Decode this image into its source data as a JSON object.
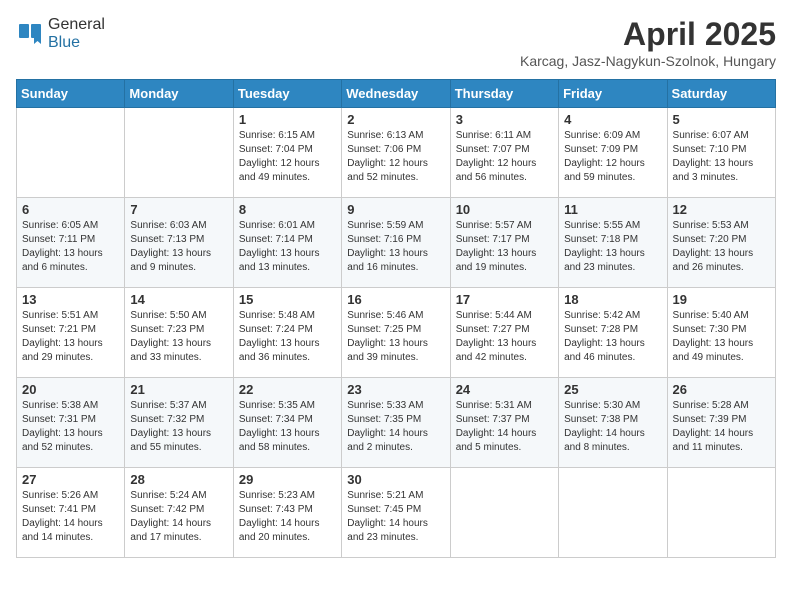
{
  "header": {
    "logo_line1": "General",
    "logo_line2": "Blue",
    "month_title": "April 2025",
    "location": "Karcag, Jasz-Nagykun-Szolnok, Hungary"
  },
  "weekdays": [
    "Sunday",
    "Monday",
    "Tuesday",
    "Wednesday",
    "Thursday",
    "Friday",
    "Saturday"
  ],
  "weeks": [
    [
      {
        "day": "",
        "info": ""
      },
      {
        "day": "",
        "info": ""
      },
      {
        "day": "1",
        "info": "Sunrise: 6:15 AM\nSunset: 7:04 PM\nDaylight: 12 hours and 49 minutes."
      },
      {
        "day": "2",
        "info": "Sunrise: 6:13 AM\nSunset: 7:06 PM\nDaylight: 12 hours and 52 minutes."
      },
      {
        "day": "3",
        "info": "Sunrise: 6:11 AM\nSunset: 7:07 PM\nDaylight: 12 hours and 56 minutes."
      },
      {
        "day": "4",
        "info": "Sunrise: 6:09 AM\nSunset: 7:09 PM\nDaylight: 12 hours and 59 minutes."
      },
      {
        "day": "5",
        "info": "Sunrise: 6:07 AM\nSunset: 7:10 PM\nDaylight: 13 hours and 3 minutes."
      }
    ],
    [
      {
        "day": "6",
        "info": "Sunrise: 6:05 AM\nSunset: 7:11 PM\nDaylight: 13 hours and 6 minutes."
      },
      {
        "day": "7",
        "info": "Sunrise: 6:03 AM\nSunset: 7:13 PM\nDaylight: 13 hours and 9 minutes."
      },
      {
        "day": "8",
        "info": "Sunrise: 6:01 AM\nSunset: 7:14 PM\nDaylight: 13 hours and 13 minutes."
      },
      {
        "day": "9",
        "info": "Sunrise: 5:59 AM\nSunset: 7:16 PM\nDaylight: 13 hours and 16 minutes."
      },
      {
        "day": "10",
        "info": "Sunrise: 5:57 AM\nSunset: 7:17 PM\nDaylight: 13 hours and 19 minutes."
      },
      {
        "day": "11",
        "info": "Sunrise: 5:55 AM\nSunset: 7:18 PM\nDaylight: 13 hours and 23 minutes."
      },
      {
        "day": "12",
        "info": "Sunrise: 5:53 AM\nSunset: 7:20 PM\nDaylight: 13 hours and 26 minutes."
      }
    ],
    [
      {
        "day": "13",
        "info": "Sunrise: 5:51 AM\nSunset: 7:21 PM\nDaylight: 13 hours and 29 minutes."
      },
      {
        "day": "14",
        "info": "Sunrise: 5:50 AM\nSunset: 7:23 PM\nDaylight: 13 hours and 33 minutes."
      },
      {
        "day": "15",
        "info": "Sunrise: 5:48 AM\nSunset: 7:24 PM\nDaylight: 13 hours and 36 minutes."
      },
      {
        "day": "16",
        "info": "Sunrise: 5:46 AM\nSunset: 7:25 PM\nDaylight: 13 hours and 39 minutes."
      },
      {
        "day": "17",
        "info": "Sunrise: 5:44 AM\nSunset: 7:27 PM\nDaylight: 13 hours and 42 minutes."
      },
      {
        "day": "18",
        "info": "Sunrise: 5:42 AM\nSunset: 7:28 PM\nDaylight: 13 hours and 46 minutes."
      },
      {
        "day": "19",
        "info": "Sunrise: 5:40 AM\nSunset: 7:30 PM\nDaylight: 13 hours and 49 minutes."
      }
    ],
    [
      {
        "day": "20",
        "info": "Sunrise: 5:38 AM\nSunset: 7:31 PM\nDaylight: 13 hours and 52 minutes."
      },
      {
        "day": "21",
        "info": "Sunrise: 5:37 AM\nSunset: 7:32 PM\nDaylight: 13 hours and 55 minutes."
      },
      {
        "day": "22",
        "info": "Sunrise: 5:35 AM\nSunset: 7:34 PM\nDaylight: 13 hours and 58 minutes."
      },
      {
        "day": "23",
        "info": "Sunrise: 5:33 AM\nSunset: 7:35 PM\nDaylight: 14 hours and 2 minutes."
      },
      {
        "day": "24",
        "info": "Sunrise: 5:31 AM\nSunset: 7:37 PM\nDaylight: 14 hours and 5 minutes."
      },
      {
        "day": "25",
        "info": "Sunrise: 5:30 AM\nSunset: 7:38 PM\nDaylight: 14 hours and 8 minutes."
      },
      {
        "day": "26",
        "info": "Sunrise: 5:28 AM\nSunset: 7:39 PM\nDaylight: 14 hours and 11 minutes."
      }
    ],
    [
      {
        "day": "27",
        "info": "Sunrise: 5:26 AM\nSunset: 7:41 PM\nDaylight: 14 hours and 14 minutes."
      },
      {
        "day": "28",
        "info": "Sunrise: 5:24 AM\nSunset: 7:42 PM\nDaylight: 14 hours and 17 minutes."
      },
      {
        "day": "29",
        "info": "Sunrise: 5:23 AM\nSunset: 7:43 PM\nDaylight: 14 hours and 20 minutes."
      },
      {
        "day": "30",
        "info": "Sunrise: 5:21 AM\nSunset: 7:45 PM\nDaylight: 14 hours and 23 minutes."
      },
      {
        "day": "",
        "info": ""
      },
      {
        "day": "",
        "info": ""
      },
      {
        "day": "",
        "info": ""
      }
    ]
  ]
}
